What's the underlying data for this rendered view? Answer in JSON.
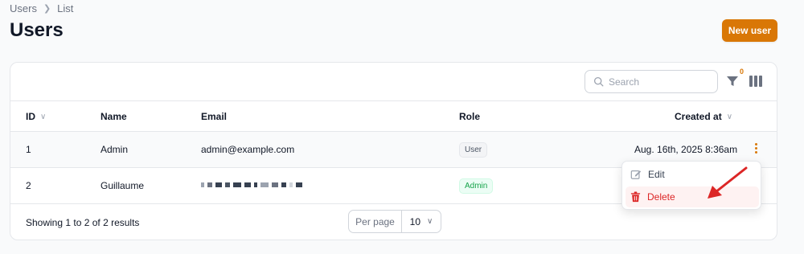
{
  "breadcrumb": {
    "items": [
      "Users",
      "List"
    ]
  },
  "page": {
    "title": "Users"
  },
  "actions": {
    "new_user_label": "New user"
  },
  "toolbar": {
    "search_placeholder": "Search",
    "filter_count": "0"
  },
  "table": {
    "columns": [
      {
        "label": "ID",
        "sortable": true
      },
      {
        "label": "Name",
        "sortable": false
      },
      {
        "label": "Email",
        "sortable": false
      },
      {
        "label": "Role",
        "sortable": false
      },
      {
        "label": "Created at",
        "sortable": true
      }
    ],
    "rows": [
      {
        "id": "1",
        "name": "Admin",
        "email": "admin@example.com",
        "role": "User",
        "created_at": "Aug. 16th, 2025 8:36am"
      },
      {
        "id": "2",
        "name": "Guillaume",
        "email": "",
        "role": "Admin",
        "created_at": ""
      }
    ]
  },
  "row_menu": {
    "edit_label": "Edit",
    "delete_label": "Delete"
  },
  "pagination": {
    "summary": "Showing 1 to 2 of 2 results",
    "per_page_label": "Per page",
    "per_page_value": "10"
  },
  "colors": {
    "accent": "#d97706",
    "danger": "#dc2626",
    "success": "#16a34a",
    "annotation_arrow": "#dc2626"
  }
}
